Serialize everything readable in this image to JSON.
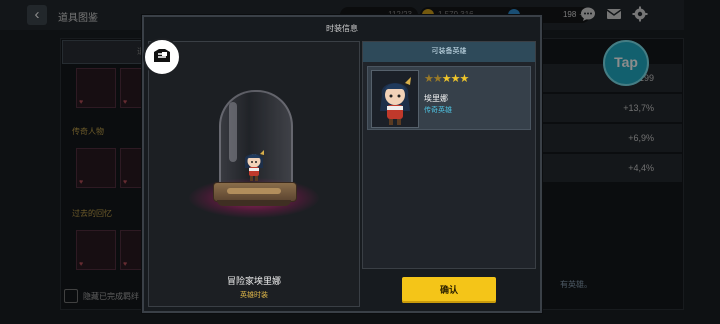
{
  "top_bar": {
    "title": "道具图鉴",
    "resources": {
      "gems": "112/23",
      "gold": "1,579,316",
      "energy": "198"
    }
  },
  "background": {
    "tab_label": "道",
    "categories": [
      "传奇人物",
      "过去的回忆"
    ],
    "hide_completed_label": "隐藏已完成羁绊",
    "progress": "40/199",
    "bonuses": [
      "+13,7%",
      "+6,9%",
      "+4,4%"
    ],
    "bottom_text": "有英雄。",
    "tap_label": "Tap"
  },
  "modal": {
    "title": "时装信息",
    "costume_name": "冒险家埃里娜",
    "costume_type": "英雄时装",
    "equippable_header": "可装备英雄",
    "hero": {
      "name": "埃里娜",
      "grade": "传奇英雄",
      "stars": 5,
      "bright_stars": 3
    },
    "confirm_label": "确认"
  },
  "colors": {
    "accent_yellow": "#f4c518",
    "legend_blue": "#4ec3e2",
    "gold_text": "#e0b84a",
    "dome_glow": "#d62878"
  }
}
